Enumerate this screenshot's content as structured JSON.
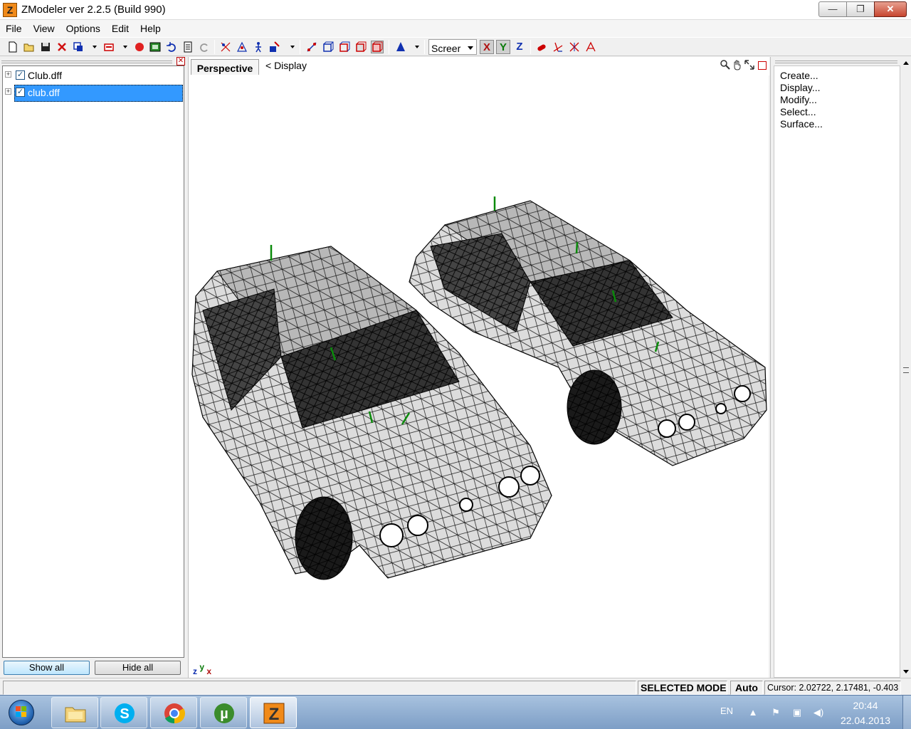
{
  "window": {
    "title": "ZModeler ver 2.2.5 (Build 990)",
    "app_icon_letter": "Z",
    "minimize_symbol": "—",
    "restore_symbol": "❐",
    "close_symbol": "✕"
  },
  "menu": {
    "items": [
      "File",
      "View",
      "Options",
      "Edit",
      "Help"
    ]
  },
  "toolbar": {
    "coord_system": "Screer",
    "axis_x": "X",
    "axis_y": "Y",
    "axis_z": "Z"
  },
  "scene_tree": {
    "close_symbol": "✕",
    "items": [
      {
        "label": "Club.dff",
        "checked": true,
        "selected": false
      },
      {
        "label": "club.dff",
        "checked": true,
        "selected": true
      }
    ],
    "expand_symbol": "+",
    "check_symbol": "✓",
    "show_all_label": "Show all",
    "hide_all_label": "Hide all"
  },
  "viewport": {
    "tab_label": "Perspective",
    "display_label": "<  Display",
    "axis_z": "z",
    "axis_y": "y",
    "axis_x": "x"
  },
  "command_panel": {
    "close_symbol": "✕",
    "items": [
      "Create...",
      "Display...",
      "Modify...",
      "Select...",
      "Surface..."
    ]
  },
  "status": {
    "mode": "SELECTED MODE",
    "auto": "Auto",
    "cursor": "Cursor: 2.02722, 2.17481, -0.403"
  },
  "taskbar": {
    "language": "EN",
    "time": "20:44",
    "date": "22.04.2013",
    "apps": [
      "explorer",
      "skype",
      "chrome",
      "utorrent",
      "zmodeler"
    ]
  },
  "colors": {
    "selection": "#3399ff",
    "axis_x": "#b01010",
    "axis_y": "#0a7a0a",
    "axis_z": "#1030b0"
  }
}
